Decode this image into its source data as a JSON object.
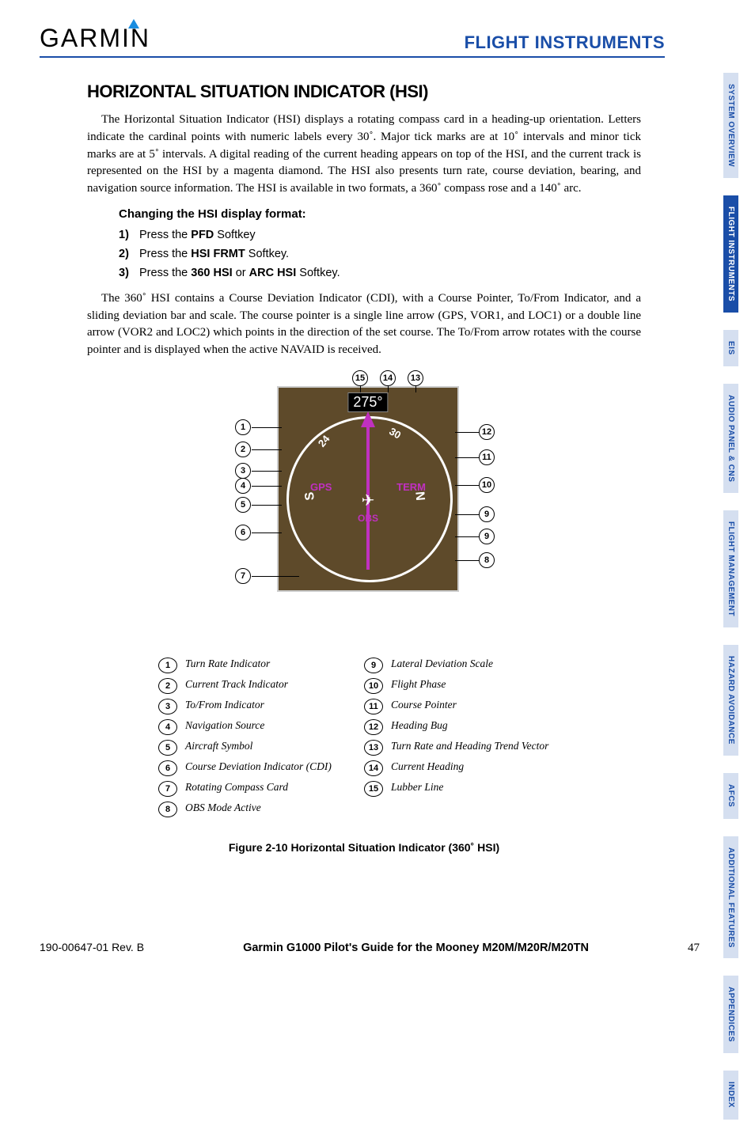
{
  "header": {
    "brand": "GARMIN",
    "section": "FLIGHT INSTRUMENTS"
  },
  "title": "HORIZONTAL SITUATION INDICATOR (HSI)",
  "para1": "The Horizontal Situation Indicator (HSI) displays a rotating compass card in a heading-up orientation.  Letters indicate the cardinal points with numeric labels every 30˚.  Major tick marks are at 10˚ intervals and minor tick marks are at 5˚ intervals.  A digital reading of the current heading appears on top of the HSI, and the current track is represented on the HSI by a magenta diamond.  The HSI also presents turn rate, course deviation, bearing, and navigation source information.  The HSI is available in two formats, a 360˚ compass rose and a 140˚ arc.",
  "subheading": "Changing the HSI display format:",
  "steps": {
    "s1n": "1)",
    "s1a": "Press the ",
    "s1b": "PFD",
    "s1c": " Softkey",
    "s2n": "2)",
    "s2a": "Press the ",
    "s2b": "HSI FRMT",
    "s2c": " Softkey.",
    "s3n": "3)",
    "s3a": "Press the ",
    "s3b": "360 HSI",
    "s3c": " or ",
    "s3d": "ARC HSI",
    "s3e": " Softkey."
  },
  "para2": "The 360˚ HSI contains a Course Deviation Indicator (CDI), with a Course Pointer, To/From Indicator, and a sliding deviation bar and scale.  The course pointer is a single line arrow (GPS, VOR1, and LOC1) or a double line arrow (VOR2 and LOC2) which points in the direction of the set course.  The To/From arrow rotates with the course pointer and is displayed when the active NAVAID is received.",
  "hsi": {
    "heading": "275°",
    "nav_source": "GPS",
    "phase": "TERM",
    "mode": "OBS",
    "north": "N",
    "south": "S",
    "d24": "24",
    "d30": "30"
  },
  "callouts": {
    "n1": "1",
    "n2": "2",
    "n3": "3",
    "n4": "4",
    "n5": "5",
    "n6": "6",
    "n7": "7",
    "n8": "8",
    "n9": "9",
    "n10": "10",
    "n11": "11",
    "n12": "12",
    "n13": "13",
    "n14": "14",
    "n15": "15"
  },
  "legend_left": [
    {
      "n": "1",
      "t": "Turn Rate Indicator"
    },
    {
      "n": "2",
      "t": "Current Track Indicator"
    },
    {
      "n": "3",
      "t": "To/From Indicator"
    },
    {
      "n": "4",
      "t": "Navigation Source"
    },
    {
      "n": "5",
      "t": "Aircraft Symbol"
    },
    {
      "n": "6",
      "t": "Course Deviation Indicator (CDI)"
    },
    {
      "n": "7",
      "t": "Rotating Compass Card"
    },
    {
      "n": "8",
      "t": "OBS Mode Active"
    }
  ],
  "legend_right": [
    {
      "n": "9",
      "t": "Lateral Deviation Scale"
    },
    {
      "n": "10",
      "t": "Flight Phase"
    },
    {
      "n": "11",
      "t": "Course Pointer"
    },
    {
      "n": "12",
      "t": "Heading Bug"
    },
    {
      "n": "13",
      "t": "Turn Rate and Heading Trend Vector"
    },
    {
      "n": "14",
      "t": "Current Heading"
    },
    {
      "n": "15",
      "t": "Lubber Line"
    }
  ],
  "figcaption": "Figure 2-10  Horizontal Situation Indicator (360˚ HSI)",
  "footer": {
    "id": "190-00647-01  Rev. B",
    "title": "Garmin G1000 Pilot's Guide for the Mooney M20M/M20R/M20TN",
    "page": "47"
  },
  "tabs": [
    {
      "t": "SYSTEM OVERVIEW",
      "active": false
    },
    {
      "t": "FLIGHT INSTRUMENTS",
      "active": true
    },
    {
      "t": "EIS",
      "active": false
    },
    {
      "t": "AUDIO PANEL & CNS",
      "active": false
    },
    {
      "t": "FLIGHT MANAGEMENT",
      "active": false
    },
    {
      "t": "HAZARD AVOIDANCE",
      "active": false
    },
    {
      "t": "AFCS",
      "active": false
    },
    {
      "t": "ADDITIONAL FEATURES",
      "active": false
    },
    {
      "t": "APPENDICES",
      "active": false
    },
    {
      "t": "INDEX",
      "active": false
    }
  ]
}
